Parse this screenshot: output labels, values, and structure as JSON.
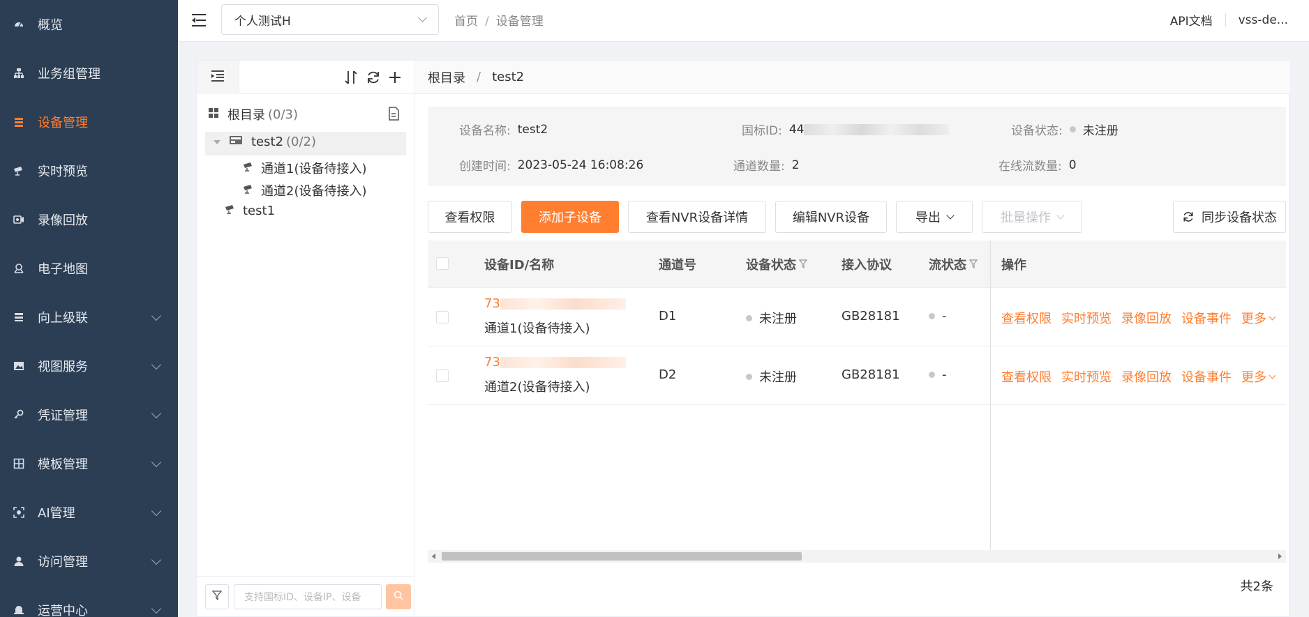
{
  "sidebar": {
    "items": [
      {
        "label": "概览",
        "icon": "dashboard-icon",
        "chevron": false,
        "active": false
      },
      {
        "label": "业务组管理",
        "icon": "org-tree-icon",
        "chevron": false,
        "active": false
      },
      {
        "label": "设备管理",
        "icon": "device-list-icon",
        "chevron": false,
        "active": true
      },
      {
        "label": "实时预览",
        "icon": "camera-icon",
        "chevron": false,
        "active": false
      },
      {
        "label": "录像回放",
        "icon": "video-record-icon",
        "chevron": false,
        "active": false
      },
      {
        "label": "电子地图",
        "icon": "map-pin-icon",
        "chevron": false,
        "active": false
      },
      {
        "label": "向上级联",
        "icon": "cascade-icon",
        "chevron": true,
        "active": false
      },
      {
        "label": "视图服务",
        "icon": "image-icon",
        "chevron": true,
        "active": false
      },
      {
        "label": "凭证管理",
        "icon": "key-icon",
        "chevron": true,
        "active": false
      },
      {
        "label": "模板管理",
        "icon": "grid-icon",
        "chevron": true,
        "active": false
      },
      {
        "label": "AI管理",
        "icon": "ai-scan-icon",
        "chevron": true,
        "active": false
      },
      {
        "label": "访问管理",
        "icon": "user-icon",
        "chevron": true,
        "active": false
      },
      {
        "label": "运营中心",
        "icon": "bell-icon",
        "chevron": true,
        "active": false
      }
    ]
  },
  "header": {
    "org_select": "个人测试H",
    "breadcrumb": [
      "首页",
      "设备管理"
    ],
    "api_docs": "API文档",
    "user": "vss-de..."
  },
  "tree": {
    "root_label": "根目录",
    "root_count": "(0/3)",
    "nodes": [
      {
        "label": "test2",
        "count": "(0/2)"
      },
      {
        "label": "通道1(设备待接入)",
        "count": ""
      },
      {
        "label": "通道2(设备待接入)",
        "count": ""
      },
      {
        "label": "test1",
        "count": ""
      }
    ],
    "search_placeholder": "支持国标ID、设备IP、设备"
  },
  "detail": {
    "breadcrumb": [
      "根目录",
      "test2"
    ],
    "info": {
      "name_key": "设备名称:",
      "name_val": "test2",
      "gbid_key": "国标ID:",
      "gbid_val": "44",
      "status_key": "设备状态:",
      "status_val": "未注册",
      "created_key": "创建时间:",
      "created_val": "2023-05-24 16:08:26",
      "channels_key": "通道数量:",
      "channels_val": "2",
      "streams_key": "在线流数量:",
      "streams_val": "0"
    },
    "buttons": {
      "view_perm": "查看权限",
      "add_child": "添加子设备",
      "nvr_detail": "查看NVR设备详情",
      "edit_nvr": "编辑NVR设备",
      "export": "导出",
      "batch": "批量操作",
      "sync": "同步设备状态"
    },
    "table": {
      "headers": [
        "设备ID/名称",
        "通道号",
        "设备状态",
        "接入协议",
        "流状态",
        "操作"
      ],
      "rows": [
        {
          "id": "73",
          "name": "通道1(设备待接入)",
          "channel": "D1",
          "status": "未注册",
          "protocol": "GB28181",
          "stream": "-"
        },
        {
          "id": "73",
          "name": "通道2(设备待接入)",
          "channel": "D2",
          "status": "未注册",
          "protocol": "GB28181",
          "stream": "-"
        }
      ],
      "actions": [
        "查看权限",
        "实时预览",
        "录像回放",
        "设备事件",
        "更多"
      ]
    },
    "total": "共2条"
  },
  "colors": {
    "accent": "#ff7e2f",
    "sidebar_bg": "#2c3e54"
  }
}
